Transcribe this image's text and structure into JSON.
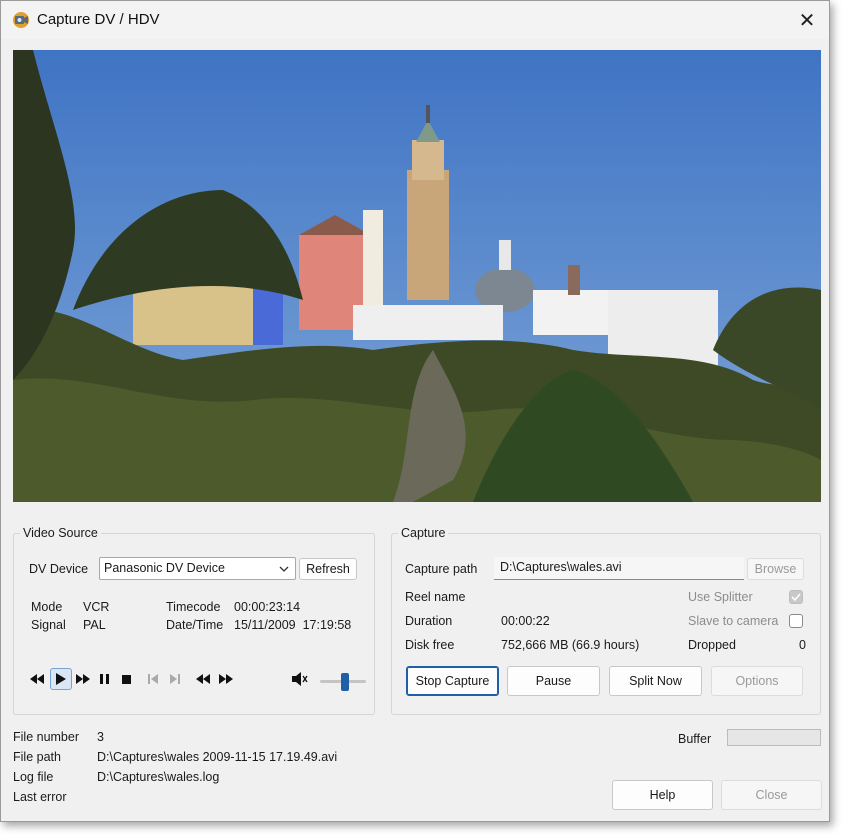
{
  "window": {
    "title": "Capture DV / HDV"
  },
  "preview": {
    "alt": "Capture DV / HDV"
  },
  "video_source": {
    "group_label": "Video Source",
    "device_label": "DV Device",
    "device_value": "Panasonic DV Device",
    "refresh_label": "Refresh",
    "mode_label": "Mode",
    "mode_value": "VCR",
    "signal_label": "Signal",
    "signal_value": "PAL",
    "timecode_label": "Timecode",
    "timecode_value": "00:00:23:14",
    "datetime_label": "Date/Time",
    "datetime_value": "15/11/2009  17:19:58",
    "transport_icons": [
      "rewind-icon",
      "play-icon",
      "fast-forward-icon",
      "pause-icon",
      "stop-icon",
      "frame-back-icon",
      "frame-forward-icon",
      "skip-back-icon",
      "skip-forward-icon",
      "volume-icon"
    ],
    "volume_level": 0.55
  },
  "capture": {
    "group_label": "Capture",
    "path_label": "Capture path",
    "path_value": "D:\\Captures\\wales.avi",
    "browse_label": "Browse",
    "reel_label": "Reel name",
    "duration_label": "Duration",
    "duration_value": "00:00:22",
    "disk_label": "Disk free",
    "disk_value": "752,666 MB (66.9 hours)",
    "splitter_label": "Use Splitter",
    "splitter_checked": true,
    "slave_label": "Slave to camera",
    "slave_checked": false,
    "dropped_label": "Dropped",
    "dropped_value": "0",
    "stop_label": "Stop Capture",
    "pause_label": "Pause",
    "split_label": "Split Now",
    "options_label": "Options"
  },
  "status": {
    "file_number_label": "File number",
    "file_number_value": "3",
    "file_path_label": "File path",
    "file_path_value": "D:\\Captures\\wales 2009-11-15 17.19.49.avi",
    "log_label": "Log file",
    "log_value": "D:\\Captures\\wales.log",
    "error_label": "Last error",
    "buffer_label": "Buffer",
    "buffer_level": 0
  },
  "footer": {
    "help_label": "Help",
    "close_label": "Close"
  },
  "colors": {
    "accent": "#1f5fa8",
    "sky": "#4a7fc6"
  }
}
